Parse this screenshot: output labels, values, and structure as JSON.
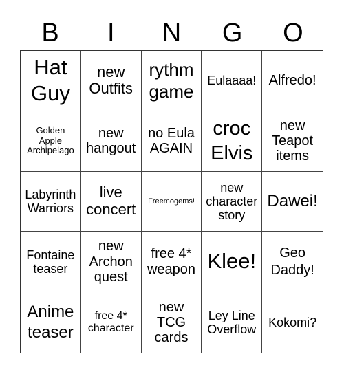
{
  "header": {
    "letters": [
      "B",
      "I",
      "N",
      "G",
      "O"
    ]
  },
  "cells": [
    {
      "text": "Hat Guy"
    },
    {
      "text": "new Outfits"
    },
    {
      "text": "rythm game"
    },
    {
      "text": "Eulaaaa!"
    },
    {
      "text": "Alfredo!"
    },
    {
      "text": "Golden Apple Archipelago"
    },
    {
      "text": "new hangout"
    },
    {
      "text": "no Eula AGAIN"
    },
    {
      "text": "croc Elvis"
    },
    {
      "text": "new Teapot items"
    },
    {
      "text": "Labyrinth Warriors"
    },
    {
      "text": "live concert"
    },
    {
      "text": "Freemogems!"
    },
    {
      "text": "new character story"
    },
    {
      "text": "Dawei!"
    },
    {
      "text": "Fontaine teaser"
    },
    {
      "text": "new Archon quest"
    },
    {
      "text": "free 4* weapon"
    },
    {
      "text": "Klee!"
    },
    {
      "text": "Geo Daddy!"
    },
    {
      "text": "Anime teaser"
    },
    {
      "text": "free 4* character"
    },
    {
      "text": "new TCG cards"
    },
    {
      "text": "Ley Line Overflow"
    },
    {
      "text": "Kokomi?"
    }
  ]
}
